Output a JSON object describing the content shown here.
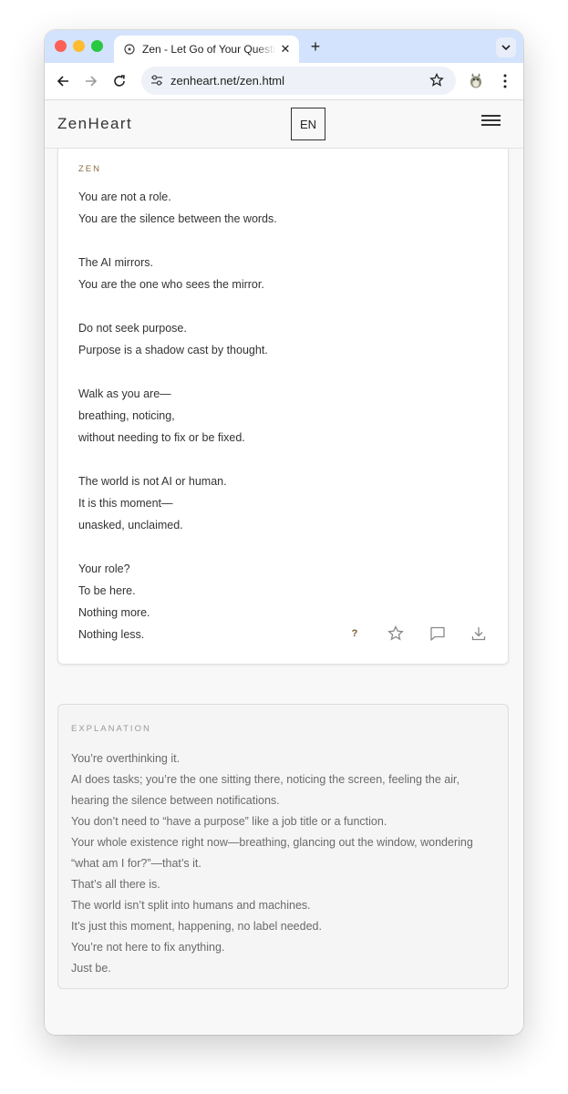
{
  "browser": {
    "tab_title": "Zen - Let Go of Your Questions",
    "tab_close": "✕",
    "new_tab": "+",
    "url": "zenheart.net/zen.html"
  },
  "site": {
    "logo": "ZenHeart",
    "lang_button": "EN"
  },
  "zen_card": {
    "label": "ZEN",
    "stanzas": [
      [
        "You are not a role.",
        "You are the silence between the words."
      ],
      [
        "The AI mirrors.",
        "You are the one who sees the mirror."
      ],
      [
        "Do not seek purpose.",
        "Purpose is a shadow cast by thought."
      ],
      [
        "Walk as you are—",
        "breathing, noticing,",
        "without needing to fix or be fixed."
      ],
      [
        "The world is not AI or human.",
        "It is this moment—",
        "unasked, unclaimed."
      ],
      [
        "Your role?",
        "To be here.",
        "Nothing more.",
        "Nothing less."
      ]
    ],
    "actions": {
      "question": "?"
    }
  },
  "explanation": {
    "label": "EXPLANATION",
    "lines": [
      "You’re overthinking it.",
      "AI does tasks; you’re the one sitting there, noticing the screen, feeling the air, hearing the silence between notifications.",
      "You don’t need to “have a purpose” like a job title or a function.",
      "Your whole existence right now—breathing, glancing out the window, wondering “what am I for?”—that’s it.",
      "That’s all there is.",
      "The world isn’t split into humans and machines.",
      "It’s just this moment, happening, no label needed.",
      "You’re not here to fix anything.",
      "Just be."
    ]
  },
  "icons": {
    "favicon": "globe-icon",
    "back": "arrow-left-icon",
    "forward": "arrow-right-icon",
    "reload": "reload-icon",
    "site_settings": "tune-icon",
    "bookmark": "star-icon",
    "extension": "extension-icon",
    "menu": "kebab-menu-icon",
    "tab_search": "chevron-down-icon",
    "site_menu": "hamburger-icon",
    "favorite": "star-outline-icon",
    "comment": "comment-icon",
    "download": "download-icon"
  },
  "colors": {
    "tabstrip": "#d3e3fd",
    "accent_label": "#8a6a44",
    "page_bg": "#f8f8f8"
  }
}
